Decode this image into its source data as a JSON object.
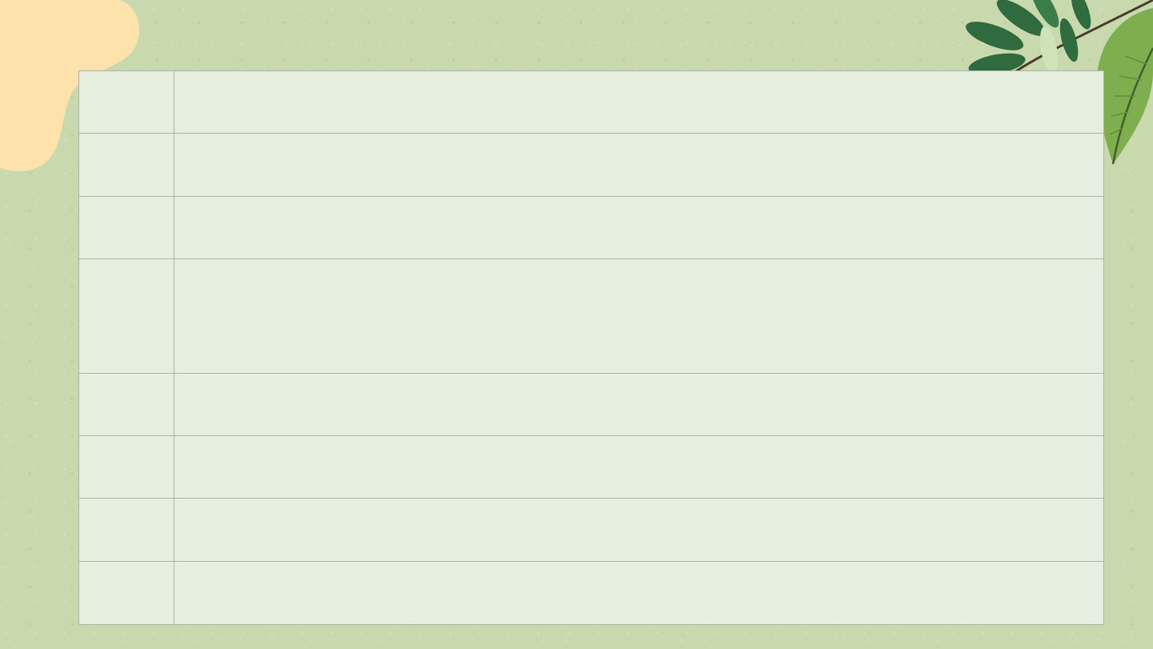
{
  "colors": {
    "background": "#c8d9ad",
    "table_fill": "#e6efdf",
    "table_border": "#a9b2a3",
    "blob": "#fde2ac",
    "leaf_dark": "#2f6b3f",
    "leaf_light": "#7fae4f"
  },
  "decorations": {
    "top_left": "peach-blob",
    "top_right": "leaf-branch-icon"
  },
  "table": {
    "rows": [
      {
        "label": "",
        "content": ""
      },
      {
        "label": "",
        "content": ""
      },
      {
        "label": "",
        "content": ""
      },
      {
        "label": "",
        "content": ""
      },
      {
        "label": "",
        "content": ""
      },
      {
        "label": "",
        "content": ""
      },
      {
        "label": "",
        "content": ""
      },
      {
        "label": "",
        "content": ""
      }
    ]
  }
}
